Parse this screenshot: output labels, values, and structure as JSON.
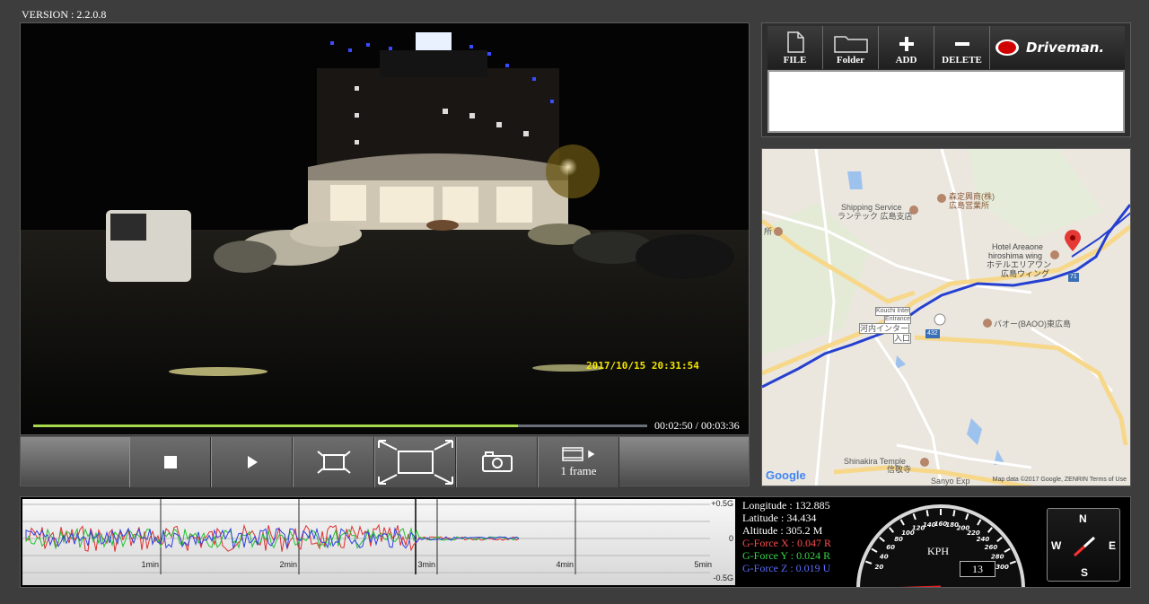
{
  "app": {
    "version": "VERSION : 2.2.0.8"
  },
  "video": {
    "overlay_timestamp": "2017/10/15 20:31:54",
    "progress_fraction": 0.79,
    "time_readout": "00:02:50 / 00:03:36"
  },
  "controls": {
    "stop_icon": "stop-icon",
    "play_icon": "play-icon",
    "fit_icon": "fit-screen-icon",
    "fullscreen_icon": "fullscreen-icon",
    "snapshot_icon": "camera-icon",
    "frame_label": "1 frame"
  },
  "file_toolbar": {
    "file_label": "FILE",
    "folder_label": "Folder",
    "add_label": "ADD",
    "delete_label": "DELETE",
    "brand": "Driveman."
  },
  "map": {
    "labels": {
      "shipping": "Shipping Service",
      "shipping_jp": "ランテック 広島支店",
      "company": "森定興商(株)",
      "company_jp": "広島営業所",
      "hotel": "Hotel Areaone",
      "hotel2": "hiroshima wing",
      "hotel_jp": "ホテルエリアワン",
      "hotel_jp2": "広島ウィング",
      "inter_en": "Kouchi Inter",
      "inter_en2": "Entrance",
      "inter_jp": "河内インター",
      "inter_jp2": "入口",
      "baoo": "バオー(BAOO)東広島",
      "temple": "Shinakira Temple",
      "temple_jp": "信敬寺",
      "sanyo": "Sanyo Exp",
      "route": "432",
      "route2": "71",
      "edge": "所"
    },
    "google": "Google",
    "attribution": "Map data ©2017 Google, ZENRIN    Terms of Use"
  },
  "gforce_chart": {
    "ticks": [
      "1min",
      "2min",
      "3min",
      "4min",
      "5min"
    ],
    "right_labels": [
      "+0.5G",
      "0",
      "-0.5G"
    ],
    "colors": {
      "x": "#e03030",
      "y": "#22c030",
      "z": "#3040e0"
    }
  },
  "telemetry": {
    "longitude": "Longitude : 132.885",
    "latitude": "Latitude  : 34.434",
    "altitude": "Altitude  : 305.2 M",
    "gforce_x": "G-Force X : 0.047 R",
    "gforce_y": "G-Force Y : 0.024 R",
    "gforce_z": "G-Force Z : 0.019 U"
  },
  "speedometer": {
    "unit": "KPH",
    "speed": "13",
    "scale": [
      "20",
      "40",
      "60",
      "80",
      "100",
      "120",
      "140",
      "160",
      "180",
      "200",
      "220",
      "240",
      "260",
      "280",
      "300"
    ]
  },
  "compass": {
    "n": "N",
    "s": "S",
    "e": "E",
    "w": "W"
  }
}
